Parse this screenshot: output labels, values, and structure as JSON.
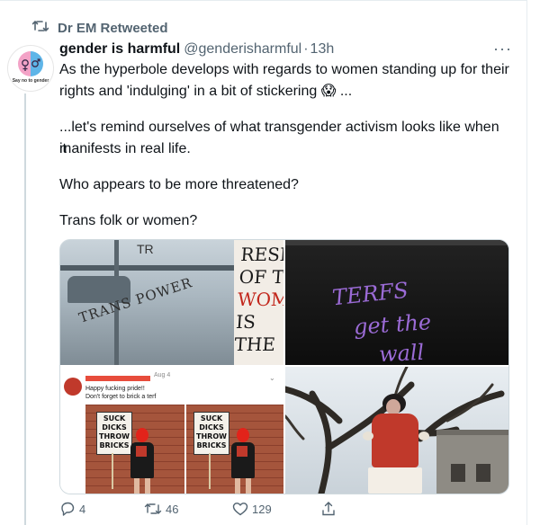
{
  "retweet": {
    "label": "Dr EM Retweeted"
  },
  "avatar": {
    "caption": "Say no to gender"
  },
  "tweet": {
    "display_name": "gender is harmful",
    "handle": "@genderisharmful",
    "separator": "·",
    "time": "13h",
    "paragraphs": [
      "As the hyperbole develops with regards to women standing up for their",
      "rights and 'indulging' in a bit of stickering 😱 ...",
      "...let's remind ourselves of what transgender activism looks like when it",
      "manifests in real life.",
      "Who appears to be more threatened?",
      "Trans folk or women?"
    ]
  },
  "media": {
    "tile1": {
      "graffiti": "TRANS POWER",
      "poster": [
        "RESI",
        "OF TH",
        "WOME",
        "IS THE"
      ],
      "corner": "TR"
    },
    "tile2": {
      "line1": "TERFS",
      "line2": "get the",
      "line3": "wall"
    },
    "tile3": {
      "date": "Aug 4",
      "line1": "Happy fucking pride!!",
      "line2": "Don't forget to brick a terf",
      "sign": [
        "SUCK",
        "DICKS",
        "THROW",
        "BRICKS"
      ]
    }
  },
  "actions": {
    "reply_count": "4",
    "retweet_count": "46",
    "like_count": "129"
  },
  "colors": {
    "gray": "#536471",
    "purple_graffiti": "#9b6bd6",
    "sign_red": "#e2231a"
  }
}
